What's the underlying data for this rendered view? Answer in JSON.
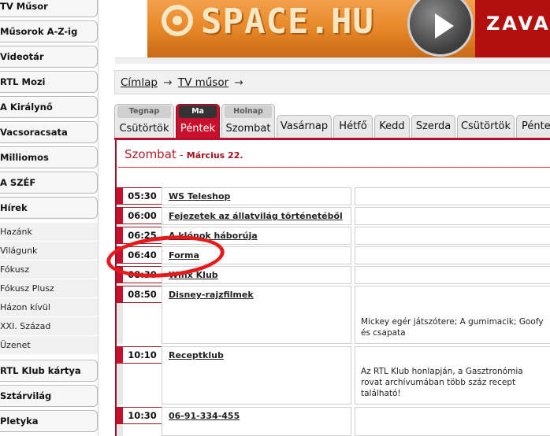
{
  "sidebar": {
    "items": [
      {
        "label": "TV Műsor"
      },
      {
        "label": "Műsorok A-Z-ig"
      },
      {
        "label": "Videotár"
      },
      {
        "label": "RTL Mozi"
      },
      {
        "label": "A Királynő"
      },
      {
        "label": "Vacsoracsata"
      },
      {
        "label": "Milliomos"
      },
      {
        "label": "A SZÉF"
      },
      {
        "label": "Hírek"
      }
    ],
    "subitems": [
      {
        "label": "Hazánk"
      },
      {
        "label": "Világunk"
      },
      {
        "label": "Fókusz"
      },
      {
        "label": "Fókusz Plusz"
      },
      {
        "label": "Házon kívül"
      },
      {
        "label": "XXI. Század"
      },
      {
        "label": "Üzenet"
      }
    ],
    "items_bottom": [
      {
        "label": "RTL Klub kártya"
      },
      {
        "label": "Sztárvilág"
      },
      {
        "label": "Pletyka"
      }
    ]
  },
  "banner": {
    "logo_text": "SPACE.HU",
    "right_text": "ZAVAR",
    "colors": {
      "orange": "#e98a2a",
      "red": "#b40f0f"
    }
  },
  "breadcrumb": {
    "items": [
      {
        "label": "Címlap"
      },
      {
        "label": "TV műsor"
      }
    ],
    "separator": "→"
  },
  "day_tabs": [
    {
      "pill": "Tegnap",
      "label": "Csütörtök",
      "active": false
    },
    {
      "pill": "Ma",
      "label": "Péntek",
      "active": true
    },
    {
      "pill": "Holnap",
      "label": "Szombat",
      "active": false
    },
    {
      "pill": "",
      "label": "Vasárnap",
      "active": false
    },
    {
      "pill": "",
      "label": "Hétfő",
      "active": false
    },
    {
      "pill": "",
      "label": "Kedd",
      "active": false
    },
    {
      "pill": "",
      "label": "Szerda",
      "active": false
    },
    {
      "pill": "",
      "label": "Csütörtök",
      "active": false
    },
    {
      "pill": "",
      "label": "Pénte",
      "active": false
    }
  ],
  "day_header": {
    "day": "Szombat",
    "separator": " - ",
    "date": "Március 22."
  },
  "programs": [
    {
      "time": "05:30",
      "title": "WS Teleshop",
      "description": ""
    },
    {
      "time": "06:00",
      "title": "Fejezetek az állatvilág történetéből",
      "description": ""
    },
    {
      "time": "06:25",
      "title": "A klónok háborúja",
      "description": ""
    },
    {
      "time": "06:40",
      "title": "Forma",
      "description": ""
    },
    {
      "time": "08:30",
      "title": "Winx Klub",
      "description": ""
    },
    {
      "time": "08:50",
      "title": "Disney-rajzfilmek",
      "description": "Mickey egér játszótere; A gumimacik; Goofy és csapata"
    },
    {
      "time": "10:10",
      "title": "Receptklub",
      "description": "Az RTL Klub honlapján, a Gasztronómia rovat archívumában több száz recept található!"
    },
    {
      "time": "10:30",
      "title": "06-91-334-455",
      "description": ""
    }
  ],
  "accent_colors": {
    "tab_active": "#c8102e",
    "header_text": "#b31a2a",
    "highlight": "#e8191a"
  }
}
